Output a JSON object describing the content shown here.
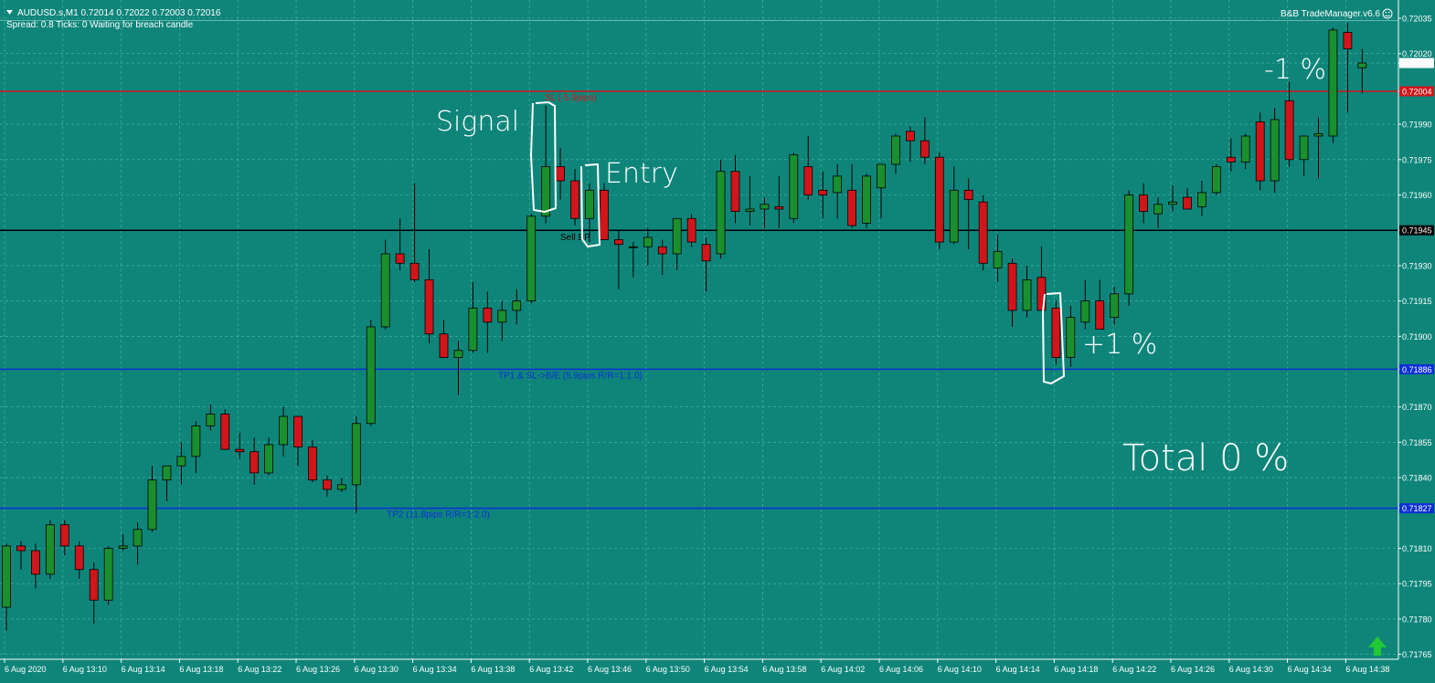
{
  "header": {
    "symbol_line": "AUDUSD.s,M1  0.72014 0.72022 0.72003 0.72016",
    "status_line": "Spread: 0.8   Ticks: 0   Waiting for breach candle",
    "manager_label": "B&B TradeManager.v6.6",
    "smiley_icon": "smiley-icon"
  },
  "colors": {
    "background": "#0f857a",
    "bull_candle": "#1a8f2e",
    "bear_candle": "#d0161a",
    "grid": "#7fd6cb",
    "sl_line": "#d0161a",
    "tp_line": "#0d2fd6",
    "entry_line": "#000000"
  },
  "price_axis": {
    "labels": [
      "0.72035",
      "0.72020",
      "0.72016",
      "0.72004",
      "0.71990",
      "0.71975",
      "0.71960",
      "0.71945",
      "0.71930",
      "0.71915",
      "0.71900",
      "0.71886",
      "0.71870",
      "0.71855",
      "0.71840",
      "0.71827",
      "0.71810",
      "0.71795",
      "0.71780",
      "0.71765"
    ],
    "range": [
      0.7176,
      0.7204
    ]
  },
  "time_axis": {
    "labels": [
      "6 Aug 2020",
      "6 Aug 13:10",
      "6 Aug 13:14",
      "6 Aug 13:18",
      "6 Aug 13:22",
      "6 Aug 13:26",
      "6 Aug 13:30",
      "6 Aug 13:34",
      "6 Aug 13:38",
      "6 Aug 13:42",
      "6 Aug 13:46",
      "6 Aug 13:50",
      "6 Aug 13:54",
      "6 Aug 13:58",
      "6 Aug 14:02",
      "6 Aug 14:06",
      "6 Aug 14:10",
      "6 Aug 14:14",
      "6 Aug 14:18",
      "6 Aug 14:22",
      "6 Aug 14:26",
      "6 Aug 14:30",
      "6 Aug 14:34",
      "6 Aug 14:38"
    ]
  },
  "levels": {
    "sl": {
      "label": "SL (-5.9pips)",
      "price": "0.72004"
    },
    "entry": {
      "label": "Sell EP",
      "price": "0.71945"
    },
    "tp1": {
      "label": "TP1 & SL->B/E (5.9pips R/R=1:1.0)",
      "price": "0.71886"
    },
    "tp2": {
      "label": "TP2 (11.8pips R/R=1:2.0)",
      "price": "0.71827"
    },
    "bid": {
      "price": "0.72016"
    },
    "ask": {
      "price": "0.72020"
    },
    "top": {
      "price": "0.72034"
    }
  },
  "annotations": {
    "signal": "Signal",
    "entry": "Entry",
    "minus1": "-1 %",
    "plus1": "+1 %",
    "total": "Total 0 %"
  },
  "buy_arrow_icon": "up-arrow-icon",
  "chart_data": {
    "type": "candlestick",
    "symbol": "AUDUSD.s",
    "timeframe": "M1",
    "candles": [
      {
        "o": 0.71785,
        "h": 0.71812,
        "l": 0.71775,
        "c": 0.71811
      },
      {
        "o": 0.71811,
        "h": 0.71813,
        "l": 0.71801,
        "c": 0.71809
      },
      {
        "o": 0.71809,
        "h": 0.71812,
        "l": 0.71793,
        "c": 0.71799
      },
      {
        "o": 0.71799,
        "h": 0.71822,
        "l": 0.71797,
        "c": 0.7182
      },
      {
        "o": 0.7182,
        "h": 0.71822,
        "l": 0.71807,
        "c": 0.71811
      },
      {
        "o": 0.71811,
        "h": 0.71813,
        "l": 0.71797,
        "c": 0.71801
      },
      {
        "o": 0.71801,
        "h": 0.71804,
        "l": 0.71778,
        "c": 0.71788
      },
      {
        "o": 0.71788,
        "h": 0.71811,
        "l": 0.71786,
        "c": 0.7181
      },
      {
        "o": 0.7181,
        "h": 0.71816,
        "l": 0.71809,
        "c": 0.71811
      },
      {
        "o": 0.71811,
        "h": 0.71821,
        "l": 0.71803,
        "c": 0.71818
      },
      {
        "o": 0.71818,
        "h": 0.71845,
        "l": 0.71817,
        "c": 0.71839
      },
      {
        "o": 0.71839,
        "h": 0.71845,
        "l": 0.7183,
        "c": 0.71845
      },
      {
        "o": 0.71845,
        "h": 0.71855,
        "l": 0.71837,
        "c": 0.71849
      },
      {
        "o": 0.71849,
        "h": 0.71864,
        "l": 0.71842,
        "c": 0.71862
      },
      {
        "o": 0.71862,
        "h": 0.71871,
        "l": 0.7186,
        "c": 0.71867
      },
      {
        "o": 0.71867,
        "h": 0.71869,
        "l": 0.71852,
        "c": 0.71852
      },
      {
        "o": 0.71852,
        "h": 0.71859,
        "l": 0.71848,
        "c": 0.71851
      },
      {
        "o": 0.71851,
        "h": 0.71857,
        "l": 0.71837,
        "c": 0.71842
      },
      {
        "o": 0.71842,
        "h": 0.71857,
        "l": 0.71841,
        "c": 0.71854
      },
      {
        "o": 0.71854,
        "h": 0.7187,
        "l": 0.71849,
        "c": 0.71866
      },
      {
        "o": 0.71866,
        "h": 0.71866,
        "l": 0.71845,
        "c": 0.71853
      },
      {
        "o": 0.71853,
        "h": 0.71856,
        "l": 0.71838,
        "c": 0.71839
      },
      {
        "o": 0.71839,
        "h": 0.71841,
        "l": 0.71832,
        "c": 0.71835
      },
      {
        "o": 0.71835,
        "h": 0.7184,
        "l": 0.71834,
        "c": 0.71837
      },
      {
        "o": 0.71837,
        "h": 0.71866,
        "l": 0.71825,
        "c": 0.71863
      },
      {
        "o": 0.71863,
        "h": 0.71907,
        "l": 0.71862,
        "c": 0.71904
      },
      {
        "o": 0.71904,
        "h": 0.71941,
        "l": 0.71903,
        "c": 0.71935
      },
      {
        "o": 0.71935,
        "h": 0.7195,
        "l": 0.71928,
        "c": 0.71931
      },
      {
        "o": 0.71931,
        "h": 0.71965,
        "l": 0.71923,
        "c": 0.71924
      },
      {
        "o": 0.71924,
        "h": 0.71937,
        "l": 0.71897,
        "c": 0.71901
      },
      {
        "o": 0.71901,
        "h": 0.71907,
        "l": 0.71892,
        "c": 0.71891
      },
      {
        "o": 0.71891,
        "h": 0.71898,
        "l": 0.71875,
        "c": 0.71894
      },
      {
        "o": 0.71894,
        "h": 0.71923,
        "l": 0.71893,
        "c": 0.71912
      },
      {
        "o": 0.71912,
        "h": 0.71919,
        "l": 0.71893,
        "c": 0.71906
      },
      {
        "o": 0.71906,
        "h": 0.71915,
        "l": 0.71898,
        "c": 0.71911
      },
      {
        "o": 0.71911,
        "h": 0.7192,
        "l": 0.71905,
        "c": 0.71915
      },
      {
        "o": 0.71915,
        "h": 0.71952,
        "l": 0.71914,
        "c": 0.71951
      },
      {
        "o": 0.71951,
        "h": 0.71998,
        "l": 0.71948,
        "c": 0.71972
      },
      {
        "o": 0.71972,
        "h": 0.7198,
        "l": 0.71958,
        "c": 0.71966
      },
      {
        "o": 0.71966,
        "h": 0.71971,
        "l": 0.71947,
        "c": 0.7195
      },
      {
        "o": 0.7195,
        "h": 0.71965,
        "l": 0.7194,
        "c": 0.71962
      },
      {
        "o": 0.71962,
        "h": 0.71965,
        "l": 0.71941,
        "c": 0.71941
      },
      {
        "o": 0.71941,
        "h": 0.71945,
        "l": 0.7192,
        "c": 0.71939
      },
      {
        "o": 0.71938,
        "h": 0.7194,
        "l": 0.71925,
        "c": 0.71938
      },
      {
        "o": 0.71938,
        "h": 0.71946,
        "l": 0.7193,
        "c": 0.71942
      },
      {
        "o": 0.71938,
        "h": 0.71941,
        "l": 0.71926,
        "c": 0.71935
      },
      {
        "o": 0.71935,
        "h": 0.7195,
        "l": 0.71928,
        "c": 0.7195
      },
      {
        "o": 0.7195,
        "h": 0.71952,
        "l": 0.71938,
        "c": 0.7194
      },
      {
        "o": 0.71939,
        "h": 0.71942,
        "l": 0.71919,
        "c": 0.71932
      },
      {
        "o": 0.71935,
        "h": 0.71975,
        "l": 0.71933,
        "c": 0.7197
      },
      {
        "o": 0.7197,
        "h": 0.71977,
        "l": 0.71948,
        "c": 0.71953
      },
      {
        "o": 0.71953,
        "h": 0.71968,
        "l": 0.71947,
        "c": 0.71954
      },
      {
        "o": 0.71954,
        "h": 0.71959,
        "l": 0.71946,
        "c": 0.71956
      },
      {
        "o": 0.71955,
        "h": 0.71968,
        "l": 0.71946,
        "c": 0.71954
      },
      {
        "o": 0.7195,
        "h": 0.71978,
        "l": 0.71948,
        "c": 0.71977
      },
      {
        "o": 0.71972,
        "h": 0.71985,
        "l": 0.71958,
        "c": 0.7196
      },
      {
        "o": 0.71962,
        "h": 0.7197,
        "l": 0.7195,
        "c": 0.7196
      },
      {
        "o": 0.71961,
        "h": 0.71973,
        "l": 0.7195,
        "c": 0.71968
      },
      {
        "o": 0.71962,
        "h": 0.71973,
        "l": 0.71946,
        "c": 0.71947
      },
      {
        "o": 0.71948,
        "h": 0.71969,
        "l": 0.71946,
        "c": 0.71968
      },
      {
        "o": 0.71963,
        "h": 0.71973,
        "l": 0.7195,
        "c": 0.71973
      },
      {
        "o": 0.71973,
        "h": 0.71986,
        "l": 0.71969,
        "c": 0.71985
      },
      {
        "o": 0.71987,
        "h": 0.71989,
        "l": 0.71974,
        "c": 0.71983
      },
      {
        "o": 0.71983,
        "h": 0.71993,
        "l": 0.71973,
        "c": 0.71976
      },
      {
        "o": 0.71976,
        "h": 0.71978,
        "l": 0.71937,
        "c": 0.7194
      },
      {
        "o": 0.7194,
        "h": 0.71972,
        "l": 0.71939,
        "c": 0.71962
      },
      {
        "o": 0.71962,
        "h": 0.71967,
        "l": 0.71937,
        "c": 0.71958
      },
      {
        "o": 0.71957,
        "h": 0.7196,
        "l": 0.71928,
        "c": 0.71931
      },
      {
        "o": 0.71929,
        "h": 0.71943,
        "l": 0.71923,
        "c": 0.71936
      },
      {
        "o": 0.71931,
        "h": 0.71933,
        "l": 0.71904,
        "c": 0.71911
      },
      {
        "o": 0.71911,
        "h": 0.7193,
        "l": 0.71908,
        "c": 0.71924
      },
      {
        "o": 0.71925,
        "h": 0.71938,
        "l": 0.71913,
        "c": 0.71911
      },
      {
        "o": 0.71912,
        "h": 0.71915,
        "l": 0.71888,
        "c": 0.71891
      },
      {
        "o": 0.71891,
        "h": 0.71913,
        "l": 0.71887,
        "c": 0.71908
      },
      {
        "o": 0.71906,
        "h": 0.71924,
        "l": 0.71903,
        "c": 0.71915
      },
      {
        "o": 0.71915,
        "h": 0.71924,
        "l": 0.71907,
        "c": 0.71903
      },
      {
        "o": 0.71908,
        "h": 0.71921,
        "l": 0.71905,
        "c": 0.71918
      },
      {
        "o": 0.71918,
        "h": 0.71962,
        "l": 0.71913,
        "c": 0.7196
      },
      {
        "o": 0.7196,
        "h": 0.71965,
        "l": 0.71948,
        "c": 0.71953
      },
      {
        "o": 0.71952,
        "h": 0.71959,
        "l": 0.71946,
        "c": 0.71956
      },
      {
        "o": 0.71956,
        "h": 0.71964,
        "l": 0.71953,
        "c": 0.71957
      },
      {
        "o": 0.71959,
        "h": 0.71963,
        "l": 0.71954,
        "c": 0.71954
      },
      {
        "o": 0.71955,
        "h": 0.71966,
        "l": 0.71951,
        "c": 0.71961
      },
      {
        "o": 0.71961,
        "h": 0.71973,
        "l": 0.7196,
        "c": 0.71972
      },
      {
        "o": 0.71976,
        "h": 0.71984,
        "l": 0.7197,
        "c": 0.71974
      },
      {
        "o": 0.71974,
        "h": 0.71986,
        "l": 0.71971,
        "c": 0.71985
      },
      {
        "o": 0.71991,
        "h": 0.71995,
        "l": 0.71962,
        "c": 0.71966
      },
      {
        "o": 0.71966,
        "h": 0.71997,
        "l": 0.71961,
        "c": 0.71992
      },
      {
        "o": 0.72,
        "h": 0.72008,
        "l": 0.71972,
        "c": 0.71975
      },
      {
        "o": 0.71975,
        "h": 0.71984,
        "l": 0.71968,
        "c": 0.71985
      },
      {
        "o": 0.71985,
        "h": 0.71993,
        "l": 0.71967,
        "c": 0.71986
      },
      {
        "o": 0.71985,
        "h": 0.72031,
        "l": 0.71982,
        "c": 0.7203
      },
      {
        "o": 0.72029,
        "h": 0.72033,
        "l": 0.71995,
        "c": 0.72022
      },
      {
        "o": 0.72014,
        "h": 0.72022,
        "l": 0.72003,
        "c": 0.72016
      }
    ]
  }
}
